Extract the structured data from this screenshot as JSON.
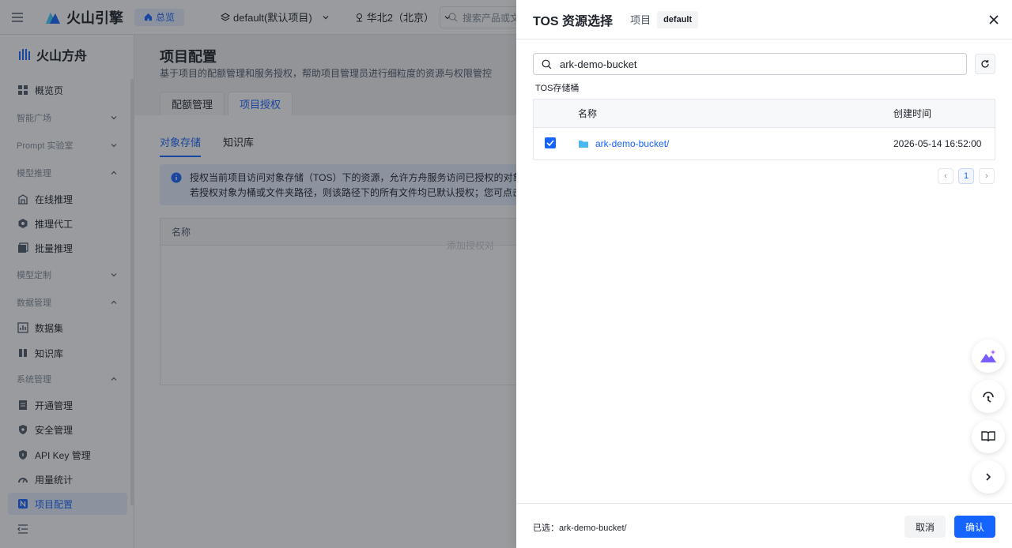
{
  "topbar": {
    "brand": "火山引擎",
    "home_label": "总览",
    "project_selector": "default(默认项目)",
    "region_selector": "华北2（北京）",
    "search_placeholder": "搜索产品或文"
  },
  "sidebar": {
    "product_name": "火山方舟",
    "items": [
      {
        "type": "item",
        "label": "概览页",
        "icon": "overview-icon"
      },
      {
        "type": "group",
        "label": "智能广场",
        "expanded": false
      },
      {
        "type": "group",
        "label": "Prompt 实验室",
        "expanded": false
      },
      {
        "type": "group",
        "label": "模型推理",
        "expanded": true
      },
      {
        "type": "item",
        "label": "在线推理",
        "icon": "building-icon"
      },
      {
        "type": "item",
        "label": "推理代工",
        "icon": "hexagon-icon"
      },
      {
        "type": "item",
        "label": "批量推理",
        "icon": "batch-icon"
      },
      {
        "type": "group",
        "label": "模型定制",
        "expanded": false
      },
      {
        "type": "group",
        "label": "数据管理",
        "expanded": true
      },
      {
        "type": "item",
        "label": "数据集",
        "icon": "dataset-icon"
      },
      {
        "type": "item",
        "label": "知识库",
        "icon": "book-icon"
      },
      {
        "type": "group",
        "label": "系统管理",
        "expanded": true
      },
      {
        "type": "item",
        "label": "开通管理",
        "icon": "document-icon"
      },
      {
        "type": "item",
        "label": "安全管理",
        "icon": "shield-icon"
      },
      {
        "type": "item",
        "label": "API Key 管理",
        "icon": "key-shield-icon"
      },
      {
        "type": "item",
        "label": "用量统计",
        "icon": "gauge-icon"
      },
      {
        "type": "item",
        "label": "项目配置",
        "icon": "project-icon",
        "active": true
      }
    ]
  },
  "main": {
    "title": "项目配置",
    "description": "基于项目的配额管理和服务授权，帮助项目管理员进行细粒度的资源与权限管控",
    "tabs": [
      "配额管理",
      "项目授权"
    ],
    "active_tab": "项目授权",
    "subtabs": [
      "对象存储",
      "知识库"
    ],
    "active_subtab": "对象存储",
    "info_line1": "授权当前项目访问对象存储（TOS）下的资源，允许方舟服务访问已授权的对象。",
    "info_line2": "若授权对象为桶或文件夹路径，则该路径下的所有文件均已默认授权；您可点击名称",
    "table_header": "名称",
    "empty_text": "添加授权对"
  },
  "drawer": {
    "title": "TOS 资源选择",
    "project_label": "项目",
    "project_tag": "default",
    "search_value": "ark-demo-bucket",
    "section_label": "TOS存储桶",
    "columns": {
      "name": "名称",
      "created": "创建时间"
    },
    "rows": [
      {
        "name": "ark-demo-bucket/",
        "created": "2026-05-14 16:52:00",
        "checked": true
      }
    ],
    "pagination": {
      "prev": "‹",
      "current": "1",
      "next": "›"
    },
    "selected_prefix": "已选：",
    "selected_value": "ark-demo-bucket/",
    "cancel_label": "取消",
    "confirm_label": "确认"
  },
  "floating": [
    "ai-assistant-icon",
    "support-icon",
    "docs-icon",
    "expand-icon"
  ],
  "colors": {
    "accent": "#1664ff",
    "folder": "#4cb6ef"
  }
}
